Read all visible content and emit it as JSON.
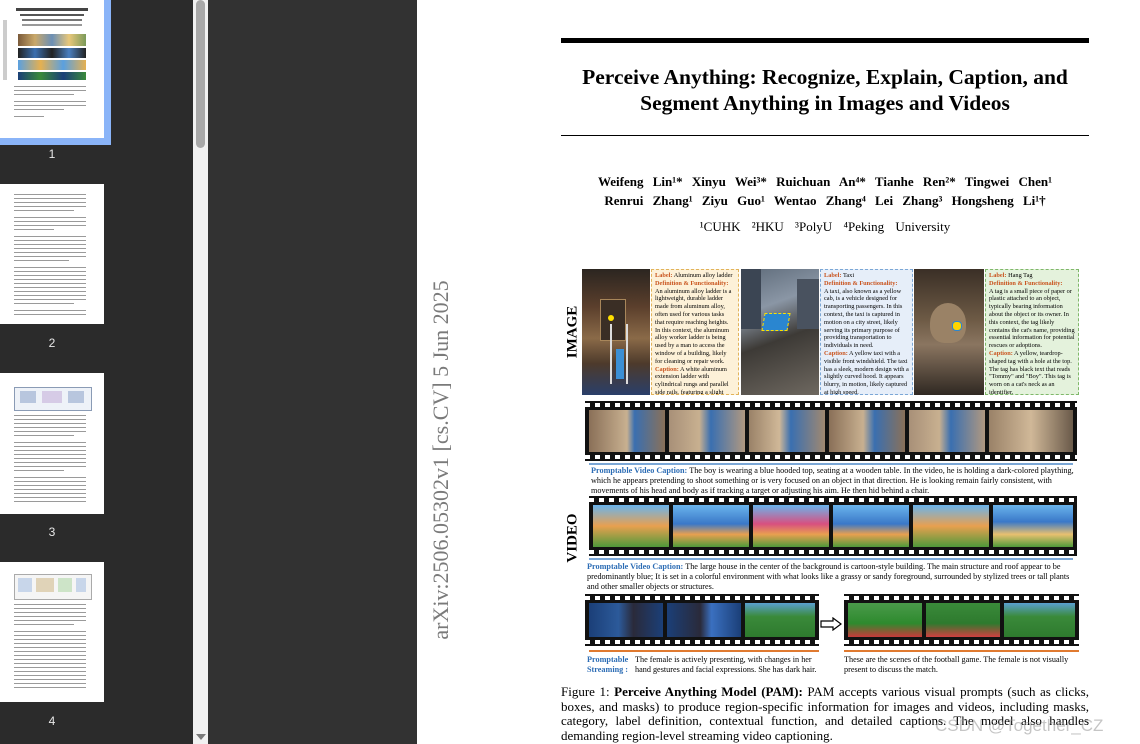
{
  "viewer": {
    "thumbnails": [
      {
        "page": "1",
        "selected": true
      },
      {
        "page": "2",
        "selected": false
      },
      {
        "page": "3",
        "selected": false
      },
      {
        "page": "4",
        "selected": false
      }
    ]
  },
  "paper": {
    "title_line1": "Perceive Anything: Recognize, Explain, Caption, and",
    "title_line2": "Segment Anything in Images and Videos",
    "authors_line1": "Weifeng Lin¹* Xinyu Wei³* Ruichuan An⁴* Tianhe Ren²* Tingwei Chen¹",
    "authors_line2": "Renrui Zhang¹ Ziyu Guo¹ Wentao Zhang⁴ Lei Zhang³ Hongsheng Li¹†",
    "affiliations": "¹CUHK ²HKU ³PolyU ⁴Peking University",
    "arxiv_id": "arXiv:2506.05302v1 [cs.CV] 5 Jun 2025",
    "figure": {
      "image_label": "IMAGE",
      "video_label": "VIDEO",
      "box1": {
        "label_key": "Label:",
        "label_val": "Aluminum alloy ladder",
        "def_key": "Definition & Functionality:",
        "def_text": "An aluminum alloy ladder is a lightweight, durable ladder made from aluminum alloy, often used for various tasks that require reaching heights. In this context, the aluminum alloy worker ladder is being used by a man to access the window of a building, likely for cleaning or repair work.",
        "cap_key": "Caption:",
        "cap_text": "A white aluminum extension ladder with cylindrical rungs and parallel side rails, featuring a slight taper towards the top."
      },
      "box2": {
        "label_key": "Label:",
        "label_val": "Taxi",
        "def_key": "Definition & Functionality:",
        "def_text": "A taxi, also known as a yellow cab, is a vehicle designed for transporting passengers. In this context, the taxi is captured in motion on a city street, likely serving its primary purpose of providing transportation to individuals in need.",
        "cap_key": "Caption:",
        "cap_text": "A yellow taxi with a visible front windshield. The taxi has a sleek, modern design with a slightly curved hood. It appears blurry, in motion, likely captured at high speed."
      },
      "box3": {
        "label_key": "Label:",
        "label_val": "Hang Tag",
        "def_key": "Definition & Functionality:",
        "def_text": "A tag is a small piece of paper or plastic attached to an object, typically bearing information about the object or its owner. In this context, the tag likely contains the cat's name, providing essential information for potential rescues or adoptions.",
        "cap_key": "Caption:",
        "cap_text": "A yellow, teardrop-shaped tag with a hole at the top. The tag has black text that reads \"Tommy\" and \"Boy\". This tag is worn on a cat's neck as an identifier."
      },
      "video_cap1_label": "Promptable Video Caption:",
      "video_cap1_text": "The boy is wearing a blue hooded top, seating at a wooden table. In the video, he is holding a dark-colored plaything, which he appears pretending to shoot something or is very focused on an object in that direction. He is looking remain fairly consistent, with movements of his head and body as if tracking a target or adjusting his aim. He then hid behind a chair.",
      "video_cap2_label": "Promptable Video Caption:",
      "video_cap2_text": "The large house in the center of the background is cartoon-style building. The main structure and roof appear to be predominantly blue; It is set in a colorful environment with what looks like a grassy or sandy foreground, surrounded by stylized trees or tall plants and other smaller objects or structures.",
      "stream_label_1": "Promptable",
      "stream_label_2": "Streaming :",
      "stream_text_left": "The female is actively presenting, with changes in her hand gestures and facial expressions. She has dark hair.",
      "stream_text_right": "These are the scenes of the football game. The female is not visually present to discuss the match.",
      "caption_prefix": "Figure 1:",
      "caption_bold": "Perceive Anything Model (PAM):",
      "caption_text": "PAM accepts various visual prompts (such as clicks, boxes, and masks) to produce region-specific information for images and videos, including masks, category, label definition, contextual function, and detailed captions. The model also handles demanding region-level streaming video captioning."
    }
  },
  "watermark": "CSDN @Together_CZ",
  "colors": {
    "sidebar_bg": "#2b2b2b",
    "selection": "#8ab4f8",
    "label_orange": "#c9541e",
    "caption_blue": "#2d6db5",
    "box1_bg": "#fdf1d8",
    "box2_bg": "#e6eef9",
    "box3_bg": "#e4f2dc"
  }
}
